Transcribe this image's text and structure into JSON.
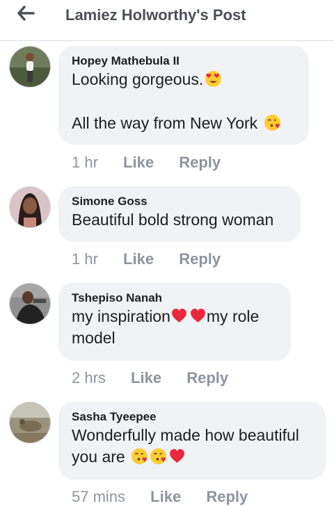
{
  "header": {
    "title": "Lamiez Holworthy's Post"
  },
  "icons": {
    "back": "arrow-left-icon",
    "heart_eyes": "heart-eyes-emoji-icon",
    "kiss": "blowing-kiss-emoji-icon",
    "heart": "red-heart-emoji-icon"
  },
  "colors": {
    "bubble": "#f0f2f5",
    "action_text": "#8d949e",
    "heart": "#e8283c",
    "emoji_face": "#ffcc33"
  },
  "comments": [
    {
      "name": "Hopey Mathebula II",
      "line1": "Looking gorgeous.",
      "line2": "All the way from New York",
      "time": "1 hr",
      "like": "Like",
      "reply": "Reply"
    },
    {
      "name": "Simone Goss",
      "line1": "Beautiful bold strong woman",
      "time": "1 hr",
      "like": "Like",
      "reply": "Reply"
    },
    {
      "name": "Tshepiso Nanah",
      "line1a": "my inspiration",
      "line1b": "my role",
      "line2": "model",
      "time": "2 hrs",
      "like": "Like",
      "reply": "Reply"
    },
    {
      "name": "Sasha Tyeepee",
      "line1": "Wonderfully made how beautiful",
      "line2": "you are",
      "time": "57 mins",
      "like": "Like",
      "reply": "Reply"
    }
  ]
}
